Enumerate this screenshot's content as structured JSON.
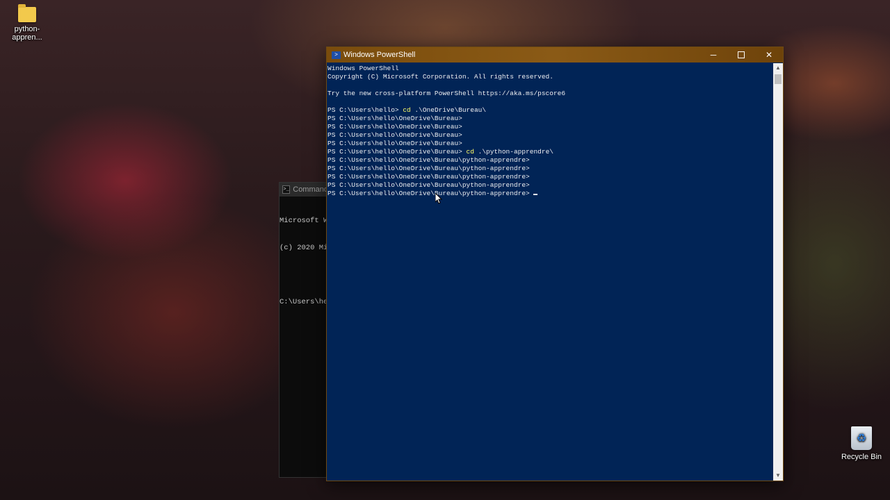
{
  "desktop": {
    "folder_icon_label": "python-appren...",
    "recycle_bin_label": "Recycle Bin"
  },
  "cmd_window": {
    "title": "Command",
    "lines": [
      "Microsoft Wi",
      "(c) 2020 Mic",
      "",
      "C:\\Users\\hel"
    ]
  },
  "powershell": {
    "title": "Windows PowerShell",
    "header_lines": [
      "Windows PowerShell",
      "Copyright (C) Microsoft Corporation. All rights reserved.",
      "",
      "Try the new cross-platform PowerShell https://aka.ms/pscore6",
      ""
    ],
    "prompts": [
      {
        "prompt": "PS C:\\Users\\hello> ",
        "cmd": "cd",
        "args": " .\\OneDrive\\Bureau\\"
      },
      {
        "prompt": "PS C:\\Users\\hello\\OneDrive\\Bureau>",
        "cmd": "",
        "args": ""
      },
      {
        "prompt": "PS C:\\Users\\hello\\OneDrive\\Bureau>",
        "cmd": "",
        "args": ""
      },
      {
        "prompt": "PS C:\\Users\\hello\\OneDrive\\Bureau>",
        "cmd": "",
        "args": ""
      },
      {
        "prompt": "PS C:\\Users\\hello\\OneDrive\\Bureau>",
        "cmd": "",
        "args": ""
      },
      {
        "prompt": "PS C:\\Users\\hello\\OneDrive\\Bureau> ",
        "cmd": "cd",
        "args": " .\\python-apprendre\\"
      },
      {
        "prompt": "PS C:\\Users\\hello\\OneDrive\\Bureau\\python-apprendre>",
        "cmd": "",
        "args": ""
      },
      {
        "prompt": "PS C:\\Users\\hello\\OneDrive\\Bureau\\python-apprendre>",
        "cmd": "",
        "args": ""
      },
      {
        "prompt": "PS C:\\Users\\hello\\OneDrive\\Bureau\\python-apprendre>",
        "cmd": "",
        "args": ""
      },
      {
        "prompt": "PS C:\\Users\\hello\\OneDrive\\Bureau\\python-apprendre>",
        "cmd": "",
        "args": ""
      },
      {
        "prompt": "PS C:\\Users\\hello\\OneDrive\\Bureau\\python-apprendre>",
        "cmd": "",
        "args": ""
      }
    ],
    "colors": {
      "background": "#012456",
      "text": "#eeedf0",
      "command": "#ffff66",
      "titlebar": "#7a4c0c"
    }
  }
}
